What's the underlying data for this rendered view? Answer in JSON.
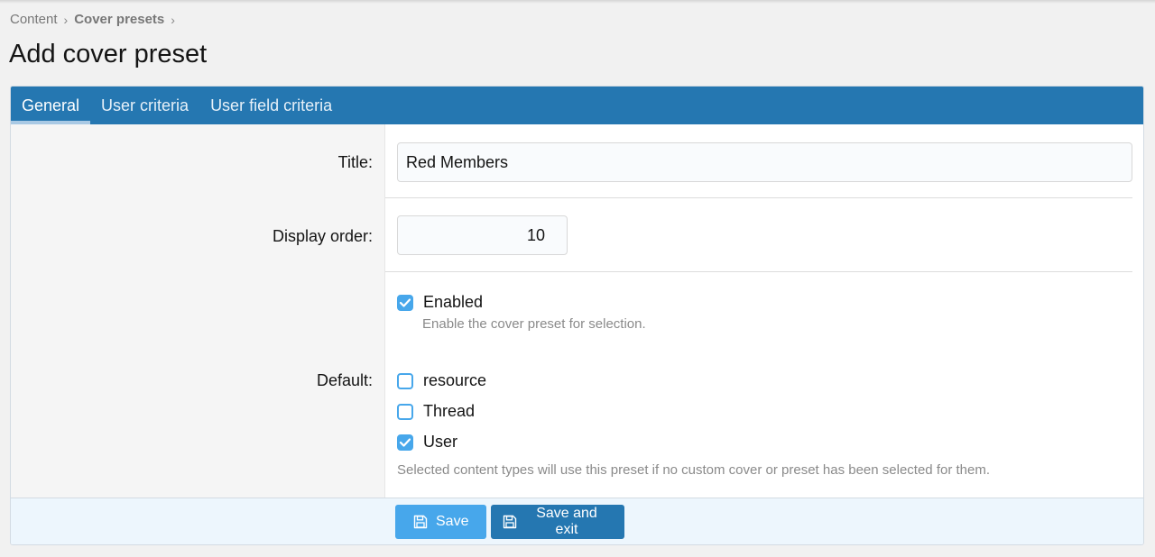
{
  "breadcrumb": {
    "items": [
      "Content",
      "Cover presets"
    ]
  },
  "page": {
    "title": "Add cover preset"
  },
  "tabs": [
    {
      "label": "General",
      "active": true
    },
    {
      "label": "User criteria",
      "active": false
    },
    {
      "label": "User field criteria",
      "active": false
    }
  ],
  "form": {
    "title_label": "Title:",
    "title_value": "Red Members",
    "display_order_label": "Display order:",
    "display_order_value": "10",
    "enabled_label": "Enabled",
    "enabled_checked": true,
    "enabled_hint": "Enable the cover preset for selection.",
    "default_label": "Default:",
    "defaults": [
      {
        "label": "resource",
        "checked": false
      },
      {
        "label": "Thread",
        "checked": false
      },
      {
        "label": "User",
        "checked": true
      }
    ],
    "default_hint": "Selected content types will use this preset if no custom cover or preset has been selected for them."
  },
  "buttons": {
    "save": "Save",
    "save_exit": "Save and exit"
  },
  "colors": {
    "tab_bar": "#2577b1",
    "checkbox": "#47a7eb",
    "save_button": "#47a7eb",
    "save_exit_button": "#2577b1"
  },
  "icons": {
    "save": "floppy-disk-icon",
    "check": "check-icon",
    "chevron": "chevron-right-icon"
  }
}
